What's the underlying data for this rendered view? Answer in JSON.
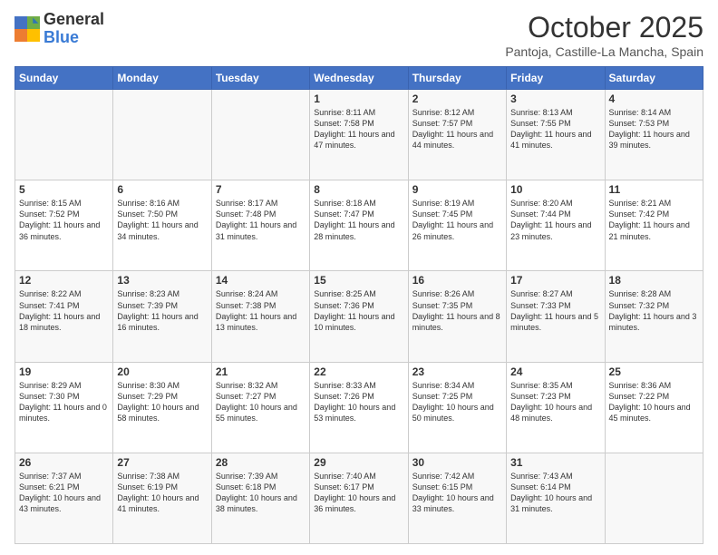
{
  "header": {
    "logo_general": "General",
    "logo_blue": "Blue",
    "month_title": "October 2025",
    "location": "Pantoja, Castille-La Mancha, Spain"
  },
  "weekdays": [
    "Sunday",
    "Monday",
    "Tuesday",
    "Wednesday",
    "Thursday",
    "Friday",
    "Saturday"
  ],
  "weeks": [
    [
      {
        "day": "",
        "info": ""
      },
      {
        "day": "",
        "info": ""
      },
      {
        "day": "",
        "info": ""
      },
      {
        "day": "1",
        "info": "Sunrise: 8:11 AM\nSunset: 7:58 PM\nDaylight: 11 hours and 47 minutes."
      },
      {
        "day": "2",
        "info": "Sunrise: 8:12 AM\nSunset: 7:57 PM\nDaylight: 11 hours and 44 minutes."
      },
      {
        "day": "3",
        "info": "Sunrise: 8:13 AM\nSunset: 7:55 PM\nDaylight: 11 hours and 41 minutes."
      },
      {
        "day": "4",
        "info": "Sunrise: 8:14 AM\nSunset: 7:53 PM\nDaylight: 11 hours and 39 minutes."
      }
    ],
    [
      {
        "day": "5",
        "info": "Sunrise: 8:15 AM\nSunset: 7:52 PM\nDaylight: 11 hours and 36 minutes."
      },
      {
        "day": "6",
        "info": "Sunrise: 8:16 AM\nSunset: 7:50 PM\nDaylight: 11 hours and 34 minutes."
      },
      {
        "day": "7",
        "info": "Sunrise: 8:17 AM\nSunset: 7:48 PM\nDaylight: 11 hours and 31 minutes."
      },
      {
        "day": "8",
        "info": "Sunrise: 8:18 AM\nSunset: 7:47 PM\nDaylight: 11 hours and 28 minutes."
      },
      {
        "day": "9",
        "info": "Sunrise: 8:19 AM\nSunset: 7:45 PM\nDaylight: 11 hours and 26 minutes."
      },
      {
        "day": "10",
        "info": "Sunrise: 8:20 AM\nSunset: 7:44 PM\nDaylight: 11 hours and 23 minutes."
      },
      {
        "day": "11",
        "info": "Sunrise: 8:21 AM\nSunset: 7:42 PM\nDaylight: 11 hours and 21 minutes."
      }
    ],
    [
      {
        "day": "12",
        "info": "Sunrise: 8:22 AM\nSunset: 7:41 PM\nDaylight: 11 hours and 18 minutes."
      },
      {
        "day": "13",
        "info": "Sunrise: 8:23 AM\nSunset: 7:39 PM\nDaylight: 11 hours and 16 minutes."
      },
      {
        "day": "14",
        "info": "Sunrise: 8:24 AM\nSunset: 7:38 PM\nDaylight: 11 hours and 13 minutes."
      },
      {
        "day": "15",
        "info": "Sunrise: 8:25 AM\nSunset: 7:36 PM\nDaylight: 11 hours and 10 minutes."
      },
      {
        "day": "16",
        "info": "Sunrise: 8:26 AM\nSunset: 7:35 PM\nDaylight: 11 hours and 8 minutes."
      },
      {
        "day": "17",
        "info": "Sunrise: 8:27 AM\nSunset: 7:33 PM\nDaylight: 11 hours and 5 minutes."
      },
      {
        "day": "18",
        "info": "Sunrise: 8:28 AM\nSunset: 7:32 PM\nDaylight: 11 hours and 3 minutes."
      }
    ],
    [
      {
        "day": "19",
        "info": "Sunrise: 8:29 AM\nSunset: 7:30 PM\nDaylight: 11 hours and 0 minutes."
      },
      {
        "day": "20",
        "info": "Sunrise: 8:30 AM\nSunset: 7:29 PM\nDaylight: 10 hours and 58 minutes."
      },
      {
        "day": "21",
        "info": "Sunrise: 8:32 AM\nSunset: 7:27 PM\nDaylight: 10 hours and 55 minutes."
      },
      {
        "day": "22",
        "info": "Sunrise: 8:33 AM\nSunset: 7:26 PM\nDaylight: 10 hours and 53 minutes."
      },
      {
        "day": "23",
        "info": "Sunrise: 8:34 AM\nSunset: 7:25 PM\nDaylight: 10 hours and 50 minutes."
      },
      {
        "day": "24",
        "info": "Sunrise: 8:35 AM\nSunset: 7:23 PM\nDaylight: 10 hours and 48 minutes."
      },
      {
        "day": "25",
        "info": "Sunrise: 8:36 AM\nSunset: 7:22 PM\nDaylight: 10 hours and 45 minutes."
      }
    ],
    [
      {
        "day": "26",
        "info": "Sunrise: 7:37 AM\nSunset: 6:21 PM\nDaylight: 10 hours and 43 minutes."
      },
      {
        "day": "27",
        "info": "Sunrise: 7:38 AM\nSunset: 6:19 PM\nDaylight: 10 hours and 41 minutes."
      },
      {
        "day": "28",
        "info": "Sunrise: 7:39 AM\nSunset: 6:18 PM\nDaylight: 10 hours and 38 minutes."
      },
      {
        "day": "29",
        "info": "Sunrise: 7:40 AM\nSunset: 6:17 PM\nDaylight: 10 hours and 36 minutes."
      },
      {
        "day": "30",
        "info": "Sunrise: 7:42 AM\nSunset: 6:15 PM\nDaylight: 10 hours and 33 minutes."
      },
      {
        "day": "31",
        "info": "Sunrise: 7:43 AM\nSunset: 6:14 PM\nDaylight: 10 hours and 31 minutes."
      },
      {
        "day": "",
        "info": ""
      }
    ]
  ]
}
